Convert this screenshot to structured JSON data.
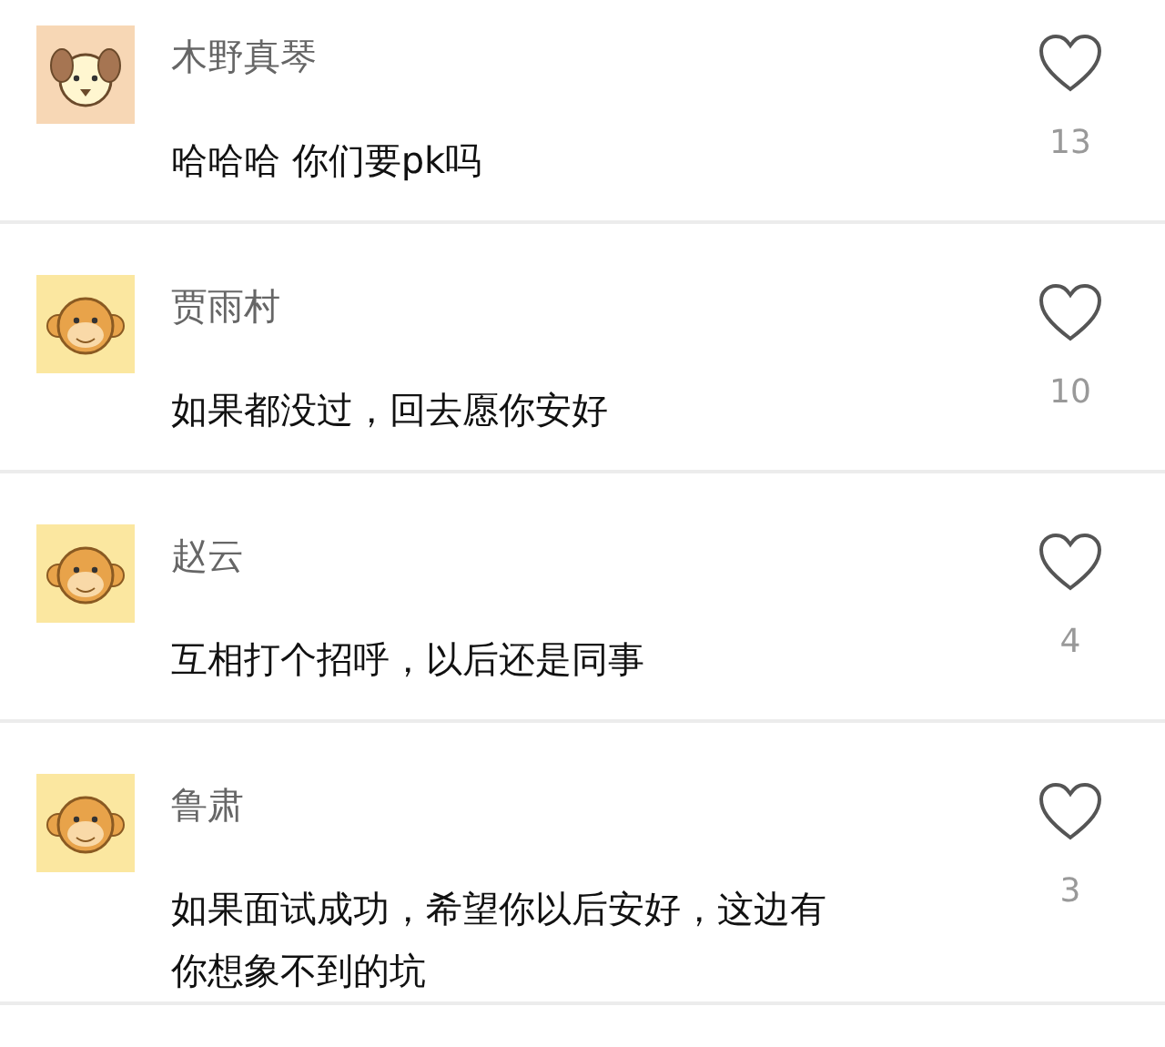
{
  "comments": [
    {
      "name": "木野真琴",
      "kind": "dog",
      "lines": [
        "哈哈哈 你们要pk吗"
      ],
      "likes": "13",
      "liked": false
    },
    {
      "name": "贾雨村",
      "kind": "monkey",
      "lines": [
        "如果都没过，回去愿你安好"
      ],
      "likes": "10",
      "liked": false
    },
    {
      "name": "赵云",
      "kind": "monkey",
      "lines": [
        "互相打个招呼，以后还是同事"
      ],
      "likes": "4",
      "liked": false
    },
    {
      "name": "鲁肃",
      "kind": "monkey",
      "lines": [
        "如果面试成功，希望你以后安好，这边有",
        "你想象不到的坑"
      ],
      "likes": "3",
      "liked": false
    }
  ]
}
